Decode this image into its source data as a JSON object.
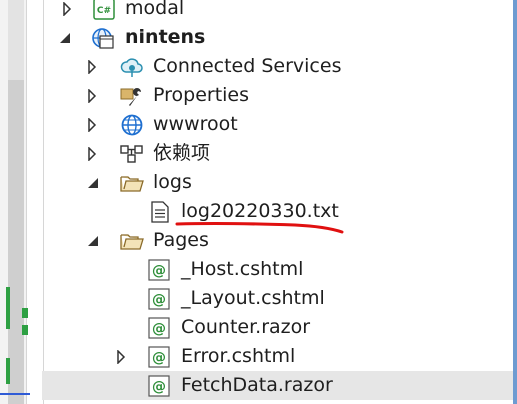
{
  "tree": {
    "items": [
      {
        "label": "modal",
        "icon": "csharp-file-icon",
        "expander": "collapsed"
      },
      {
        "label": "nintens",
        "icon": "web-project-icon",
        "expander": "expanded"
      },
      {
        "label": "Connected Services",
        "icon": "connected-services-icon",
        "expander": "collapsed"
      },
      {
        "label": "Properties",
        "icon": "wrench-icon",
        "expander": "collapsed"
      },
      {
        "label": "wwwroot",
        "icon": "globe-icon",
        "expander": "collapsed"
      },
      {
        "label": "依赖项",
        "icon": "dependencies-icon",
        "expander": "collapsed"
      },
      {
        "label": "logs",
        "icon": "folder-icon",
        "expander": "expanded"
      },
      {
        "label": "log20220330.txt",
        "icon": "text-file-icon"
      },
      {
        "label": "Pages",
        "icon": "folder-icon",
        "expander": "expanded"
      },
      {
        "label": "_Host.cshtml",
        "icon": "razor-file-icon"
      },
      {
        "label": "_Layout.cshtml",
        "icon": "razor-file-icon"
      },
      {
        "label": "Counter.razor",
        "icon": "razor-file-icon"
      },
      {
        "label": "Error.cshtml",
        "icon": "razor-file-icon",
        "expander": "collapsed"
      },
      {
        "label": "FetchData.razor",
        "icon": "razor-file-icon",
        "selected": true
      }
    ]
  },
  "colors": {
    "annotation": "#e01010",
    "folder": "#d9b56a",
    "razor": "#2f8f3a",
    "globe": "#1e6fd0",
    "selection": "#e6e6e6"
  }
}
